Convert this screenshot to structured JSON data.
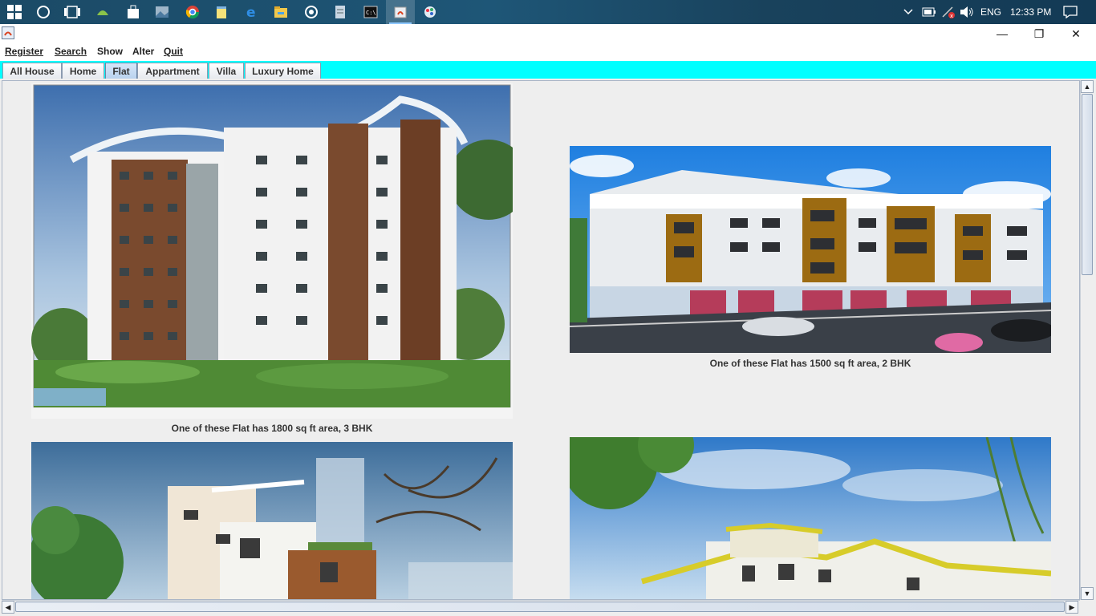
{
  "taskbar": {
    "icons": [
      "windows-start-icon",
      "cortana-icon",
      "task-view-icon",
      "android-studio-icon",
      "store-icon",
      "photos-icon",
      "chrome-icon",
      "notepad-icon",
      "edge-icon",
      "file-explorer-icon",
      "media-icon",
      "notes-icon",
      "cmd-icon",
      "java-app-icon",
      "paint-icon"
    ],
    "language": "ENG",
    "time": "12:33 PM"
  },
  "window": {
    "minimize": "—",
    "restore": "❐",
    "close": "✕"
  },
  "menu": [
    "Register",
    "Search",
    "Show",
    "Alter",
    "Quit"
  ],
  "tabs": [
    "All House",
    "Home",
    "Flat",
    "Appartment",
    "Villa",
    "Luxury Home"
  ],
  "selected_tab": "Flat",
  "listings": [
    {
      "caption": "One of these Flat has 1800 sq ft area, 3 BHK"
    },
    {
      "caption": "One of these Flat has 1500 sq ft area, 2 BHK"
    }
  ],
  "scroll": {
    "up": "▲",
    "down": "▼",
    "left": "◀",
    "right": "▶"
  },
  "colors": {
    "tab_strip": "#00ffff",
    "taskbar": "#1e5677"
  }
}
